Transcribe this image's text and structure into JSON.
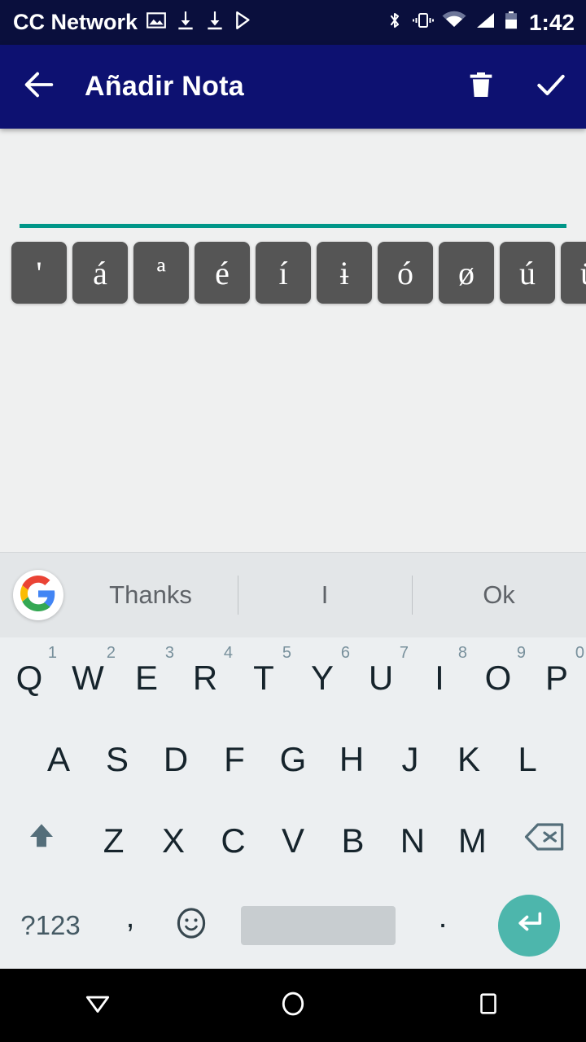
{
  "status_bar": {
    "carrier": "CC Network",
    "clock": "1:42",
    "left_icons": [
      "image-icon",
      "download-icon",
      "download-icon",
      "play-store-icon"
    ],
    "right_icons": [
      "bluetooth-icon",
      "vibrate-icon",
      "wifi-icon",
      "cellular-signal-icon",
      "battery-icon"
    ],
    "background_color": "#0a0f3d"
  },
  "app_bar": {
    "title": "Añadir Nota",
    "back_icon": "arrow-left-icon",
    "delete_icon": "trash-icon",
    "confirm_icon": "check-icon",
    "background_color": "#0d1171"
  },
  "editor": {
    "note_value": "",
    "note_placeholder": "",
    "underline_color": "#009688"
  },
  "accent_popup": {
    "keys": [
      "'",
      "á",
      "ª",
      "é",
      "í",
      "ɨ",
      "ó",
      "ø",
      "ú",
      "ü"
    ],
    "key_background": "#555555",
    "has_clipped_trailing_key": true
  },
  "suggestion_strip": {
    "logo": "google-g-icon",
    "suggestions": [
      "Thanks",
      "I",
      "Ok"
    ],
    "background_color": "#e3e6e8"
  },
  "keyboard": {
    "background_color": "#eceff1",
    "row_qwerty": [
      {
        "label": "Q",
        "hint": "1"
      },
      {
        "label": "W",
        "hint": "2"
      },
      {
        "label": "E",
        "hint": "3"
      },
      {
        "label": "R",
        "hint": "4"
      },
      {
        "label": "T",
        "hint": "5"
      },
      {
        "label": "Y",
        "hint": "6"
      },
      {
        "label": "U",
        "hint": "7"
      },
      {
        "label": "I",
        "hint": "8"
      },
      {
        "label": "O",
        "hint": "9"
      },
      {
        "label": "P",
        "hint": "0"
      }
    ],
    "row_asdf": [
      "A",
      "S",
      "D",
      "F",
      "G",
      "H",
      "J",
      "K",
      "L"
    ],
    "row_zxcv": [
      "Z",
      "X",
      "C",
      "V",
      "B",
      "N",
      "M"
    ],
    "shift_icon": "shift-up-arrow-icon",
    "backspace_icon": "backspace-icon",
    "bottom_row": {
      "symbols_label": "?123",
      "comma_label": ",",
      "emoji_icon": "smiley-face-icon",
      "space_label": "",
      "period_label": ".",
      "enter_icon": "enter-return-icon",
      "enter_color": "#4db6ac"
    }
  },
  "nav_bar": {
    "back_icon": "nav-back-triangle-icon",
    "home_icon": "nav-home-circle-icon",
    "recents_icon": "nav-recents-square-icon",
    "background_color": "#000000"
  }
}
